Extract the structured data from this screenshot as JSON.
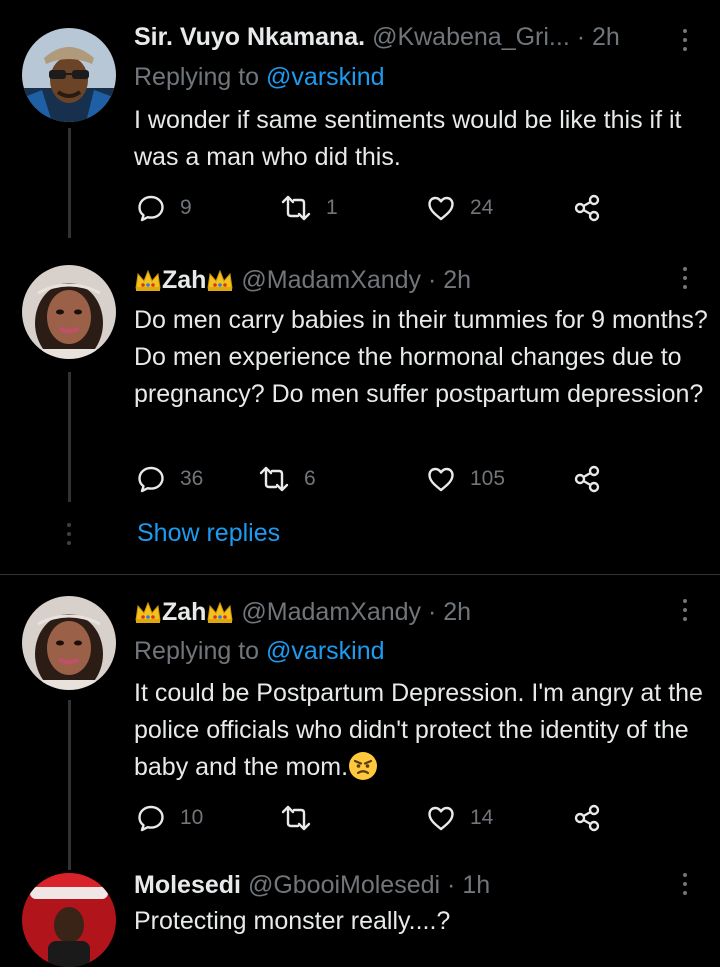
{
  "tweets": [
    {
      "name": "Sir. Vuyo Nkamana.",
      "handle": "@Kwabena_Gri...",
      "dot": "·",
      "time": "2h",
      "replying_prefix": "Replying to ",
      "replying_to": "@varskind",
      "text": "I wonder if same sentiments would be like this if it was a man who did this.",
      "replies": "9",
      "retweets": "1",
      "likes": "24"
    },
    {
      "name": "Zah",
      "handle": "@MadamXandy",
      "dot": "·",
      "time": "2h",
      "text": "Do men carry babies in their tummies for 9 months? Do men experience the hormonal changes due to pregnancy? Do men suffer postpartum depression?",
      "replies": "36",
      "retweets": "6",
      "likes": "105",
      "show_replies": "Show replies"
    },
    {
      "name": "Zah",
      "handle": "@MadamXandy",
      "dot": "·",
      "time": "2h",
      "replying_prefix": "Replying to ",
      "replying_to": "@varskind",
      "text": "It could be Postpartum Depression. I'm angry at the police officials who didn't protect the identity of the baby and the mom.",
      "replies": "10",
      "retweets": "",
      "likes": "14"
    },
    {
      "name": "Molesedi",
      "handle": "@GbooiMolesedi",
      "dot": "·",
      "time": "1h",
      "text": "Protecting monster really....?"
    }
  ],
  "colors": {
    "background": "#000000",
    "text": "#e7e9ea",
    "secondary": "#71767b",
    "link": "#1d9bf0",
    "divider": "#2f3336"
  }
}
